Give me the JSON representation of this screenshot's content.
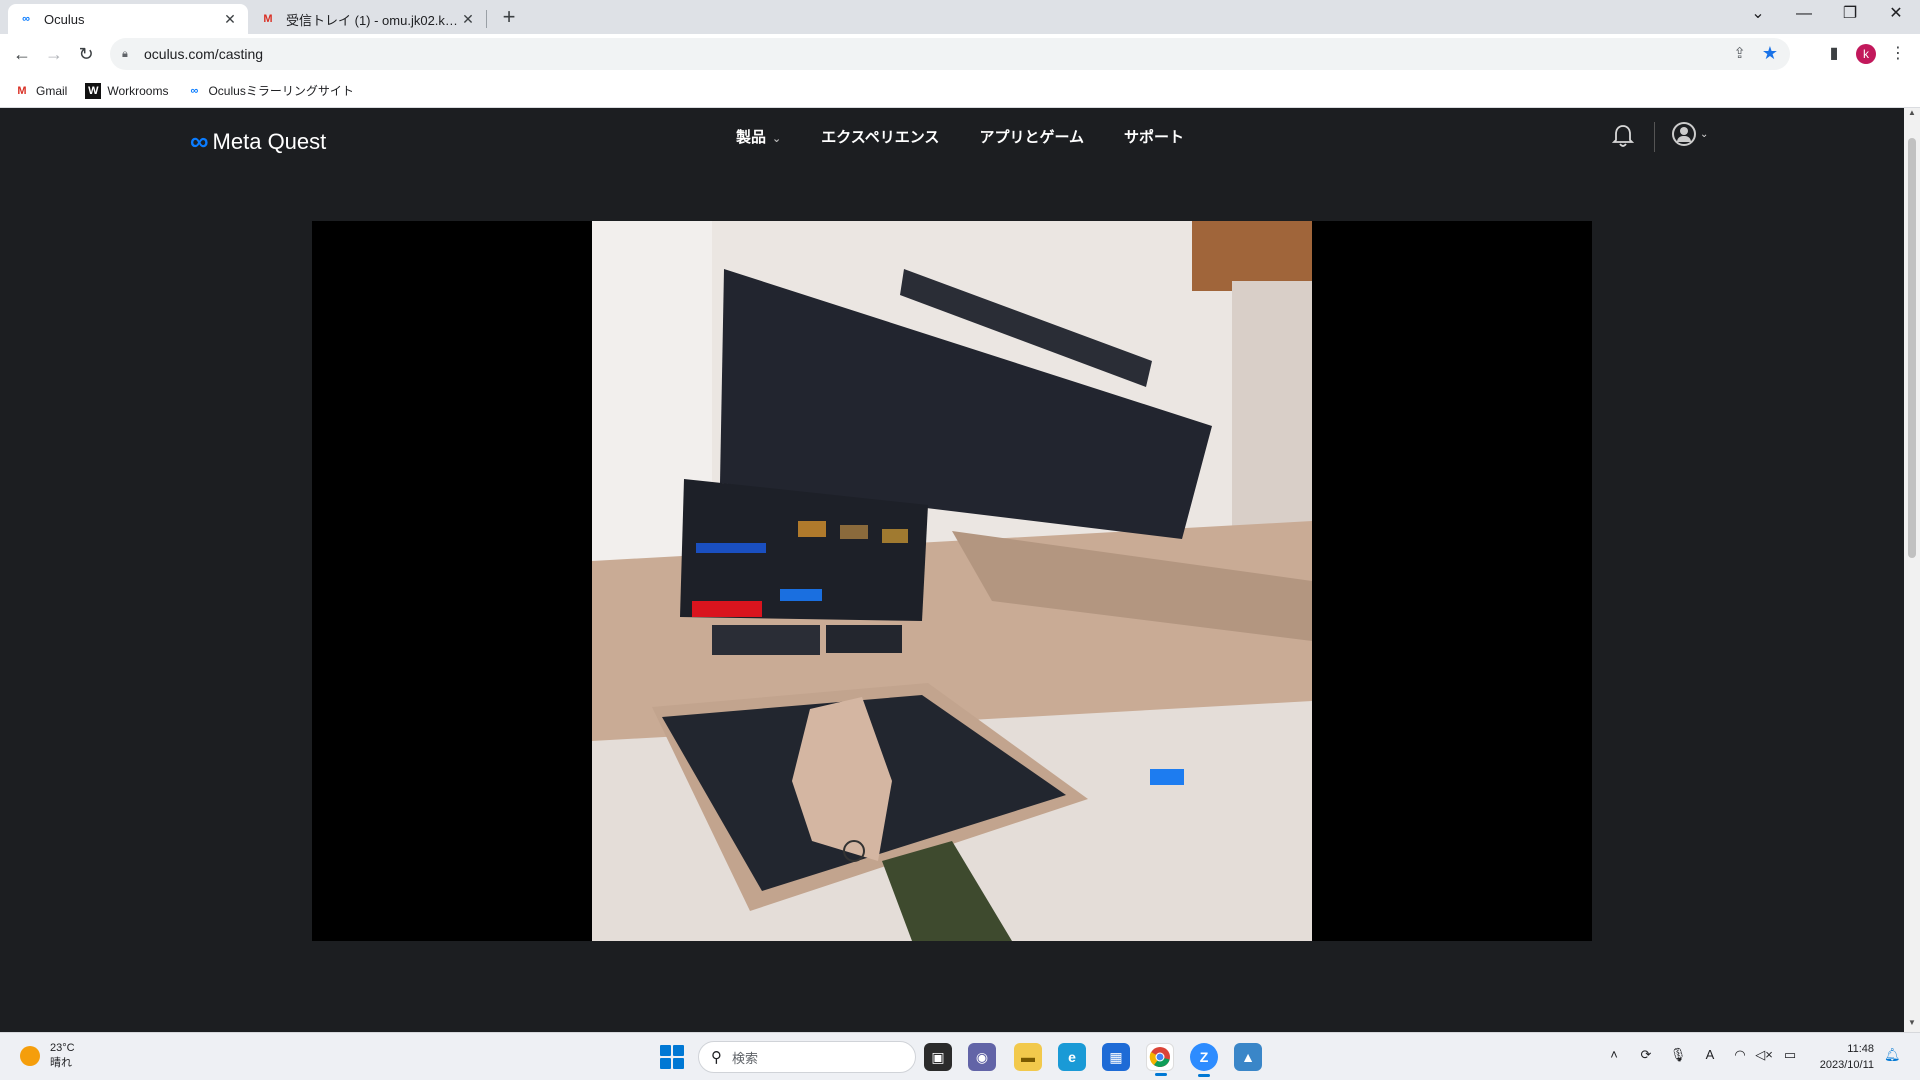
{
  "browser": {
    "tabs": [
      {
        "title": "Oculus",
        "favicon": "meta-icon",
        "active": true
      },
      {
        "title": "受信トレイ (1) - omu.jk02.kosen@",
        "favicon": "gmail-icon",
        "active": false
      }
    ],
    "url": "oculus.com/casting",
    "profile_initial": "k",
    "bookmarks": [
      {
        "label": "Gmail",
        "icon": "gmail-icon"
      },
      {
        "label": "Workrooms",
        "icon": "workrooms-icon"
      },
      {
        "label": "Oculusミラーリングサイト",
        "icon": "meta-icon"
      }
    ]
  },
  "site": {
    "logo_text": "Meta Quest",
    "nav": [
      {
        "label": "製品",
        "has_dropdown": true
      },
      {
        "label": "エクスペリエンス",
        "has_dropdown": false
      },
      {
        "label": "アプリとゲーム",
        "has_dropdown": false
      },
      {
        "label": "サポート",
        "has_dropdown": false
      }
    ]
  },
  "taskbar": {
    "weather_temp": "23°C",
    "weather_desc": "晴れ",
    "search_placeholder": "検索",
    "time": "11:48",
    "date": "2023/10/11"
  },
  "colors": {
    "page_bg": "#1c1e21",
    "accent": "#0a7cff",
    "taskbar_accent": "#0078d4"
  }
}
